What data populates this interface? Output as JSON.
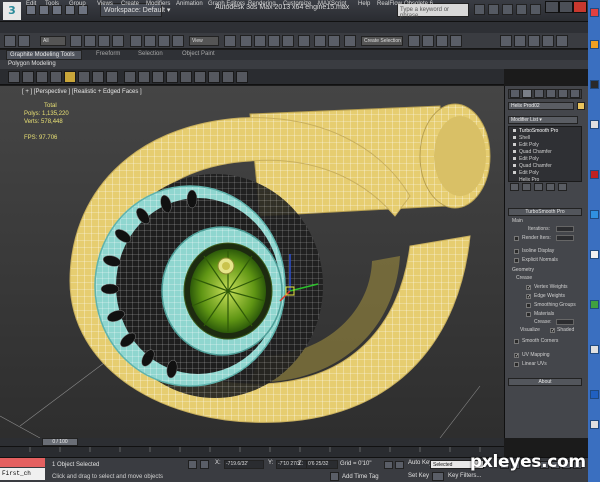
{
  "titlebar": {
    "logo": "3",
    "workspace": "Workspace: Default",
    "title": "Autodesk 3ds Max 2013 x64     engine15.max",
    "search_placeholder": "Type a keyword or phrase"
  },
  "menu": [
    "Edit",
    "Tools",
    "Group",
    "Views",
    "Create",
    "Modifiers",
    "Animation",
    "Graph Editors",
    "Rendering",
    "Customize",
    "MAXScript",
    "Help",
    "RealFlow",
    "Obsolete 6"
  ],
  "main_toolbar": {
    "selection_filter": "All",
    "reference_coord": "View",
    "named_selection": "Create Selection Se"
  },
  "ribbon": {
    "tabs": [
      "Graphite Modeling Tools",
      "Freeform",
      "Selection",
      "Object Paint"
    ],
    "subtitle": "Polygon Modeling"
  },
  "viewport": {
    "label": "[ + ] [Perspective ] [Realistic + Edged Faces ]",
    "stats_header": "Total",
    "polys_label": "Polys:",
    "polys_value": "1,135,220",
    "verts_label": "Verts:",
    "verts_value": "578,448",
    "fps_label": "FPS:",
    "fps_value": "97.706"
  },
  "command_panel": {
    "object_name": "Helix Prod02",
    "object_color": "#e8c35c",
    "modifier_list": "Modifier List",
    "stack": [
      "TurboSmooth Pro",
      "Shell",
      "Edit Poly",
      "Quad Chamfer",
      "Edit Poly",
      "Quad Chamfer",
      "Edit Poly",
      "Helix Pro"
    ],
    "rollout_title": "TurboSmooth Pro",
    "main_label": "Main",
    "iterations_label": "Iterations:",
    "render_iters_label": "Render Iters:",
    "isoline_label": "Isoline Display",
    "explicit_normals_label": "Explicit Normals",
    "geometry_label": "Geometry",
    "crease_label": "Crease",
    "vertex_weights_label": "Vertex Weights",
    "edge_weights_label": "Edge Weights",
    "smoothing_groups_label": "Smoothing Groups",
    "materials_label": "Materials",
    "crease_field_label": "Crease:",
    "visualize_label": "Visualize",
    "shaded_label": "Shaded",
    "smooth_corners_label": "Smooth Corners",
    "uv_mapping_label": "UV Mapping",
    "linear_uvs_label": "Linear UVs",
    "about_label": "About"
  },
  "timeline": {
    "frame": "0 / 100"
  },
  "statusbar": {
    "maxscript": "First_ch",
    "selection": "1 Object Selected",
    "prompt": "Click and drag to select and move objects",
    "x_label": "X:",
    "x_value": "-719.6/32'",
    "y_label": "Y:",
    "y_value": "-7'10 27/3",
    "z_label": "Z:",
    "z_value": "0'6 25/32",
    "grid": "Grid = 0'10\"",
    "add_time_tag": "Add Time Tag",
    "auto_key": "Auto Key",
    "set_key": "Set Key",
    "selected": "Selected",
    "key_filters": "Key Filters..."
  },
  "watermark": "pxleyes.com",
  "colors": {
    "housing": "#e9cf72",
    "inlet_ring": "#8ddad3",
    "impeller": "#6a9a18",
    "wire": "#ffffff"
  }
}
